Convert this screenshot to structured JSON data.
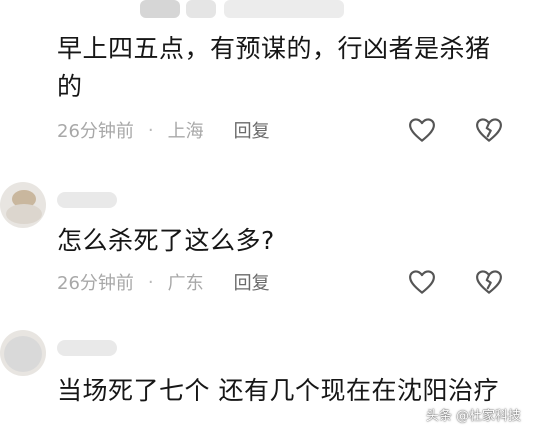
{
  "comments": [
    {
      "text": "早上四五点，有预谋的，行凶者是杀猪的",
      "time": "26分钟前",
      "location": "上海",
      "reply_label": "回复",
      "like_icon": "heart-outline-icon",
      "dislike_icon": "broken-heart-icon"
    },
    {
      "text": "怎么杀死了这么多?",
      "time": "26分钟前",
      "location": "广东",
      "reply_label": "回复",
      "like_icon": "heart-outline-icon",
      "dislike_icon": "broken-heart-icon"
    },
    {
      "text": "当场死了七个  还有几个现在在沈阳治疗"
    }
  ],
  "meta_separator": "·",
  "watermark": "头条 @杜家科技",
  "colors": {
    "text": "#161616",
    "meta": "#a8a8a8",
    "reply": "#6a6a6a",
    "icon": "#555555"
  }
}
